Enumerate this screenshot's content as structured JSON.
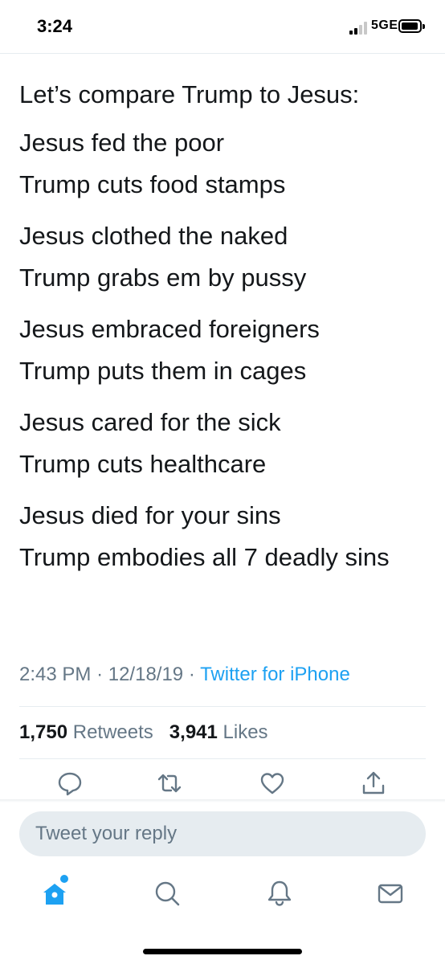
{
  "status_bar": {
    "time": "3:24",
    "network": "5GE",
    "signal_bars": 2,
    "signal_total": 4
  },
  "tweet": {
    "intro": "Let’s compare Trump to Jesus:",
    "stanzas": [
      [
        "Jesus fed the poor",
        "Trump cuts food stamps"
      ],
      [
        "Jesus clothed the naked",
        "Trump grabs em by pussy"
      ],
      [
        "Jesus embraced foreigners",
        "Trump puts them in cages"
      ],
      [
        "Jesus cared for the sick",
        "Trump cuts healthcare"
      ],
      [
        "Jesus died for your sins",
        "Trump embodies all 7 deadly sins"
      ]
    ],
    "time": "2:43 PM",
    "date": "12/18/19",
    "separator": "·",
    "source": "Twitter for iPhone",
    "retweets_count": "1,750",
    "retweets_label": "Retweets",
    "likes_count": "3,941",
    "likes_label": "Likes"
  },
  "actions": {
    "icons": [
      "reply-icon",
      "retweet-icon",
      "like-icon",
      "share-icon"
    ]
  },
  "reply": {
    "placeholder": "Tweet your reply"
  },
  "tab_bar": {
    "icons": [
      "home-icon",
      "search-icon",
      "notifications-icon",
      "messages-icon"
    ],
    "home_has_badge": true
  },
  "colors": {
    "accent": "#1da1f2",
    "text": "#14171a",
    "secondary_text": "#657786",
    "divider": "#e6ecf0",
    "reply_box": "#e6ecf0"
  }
}
